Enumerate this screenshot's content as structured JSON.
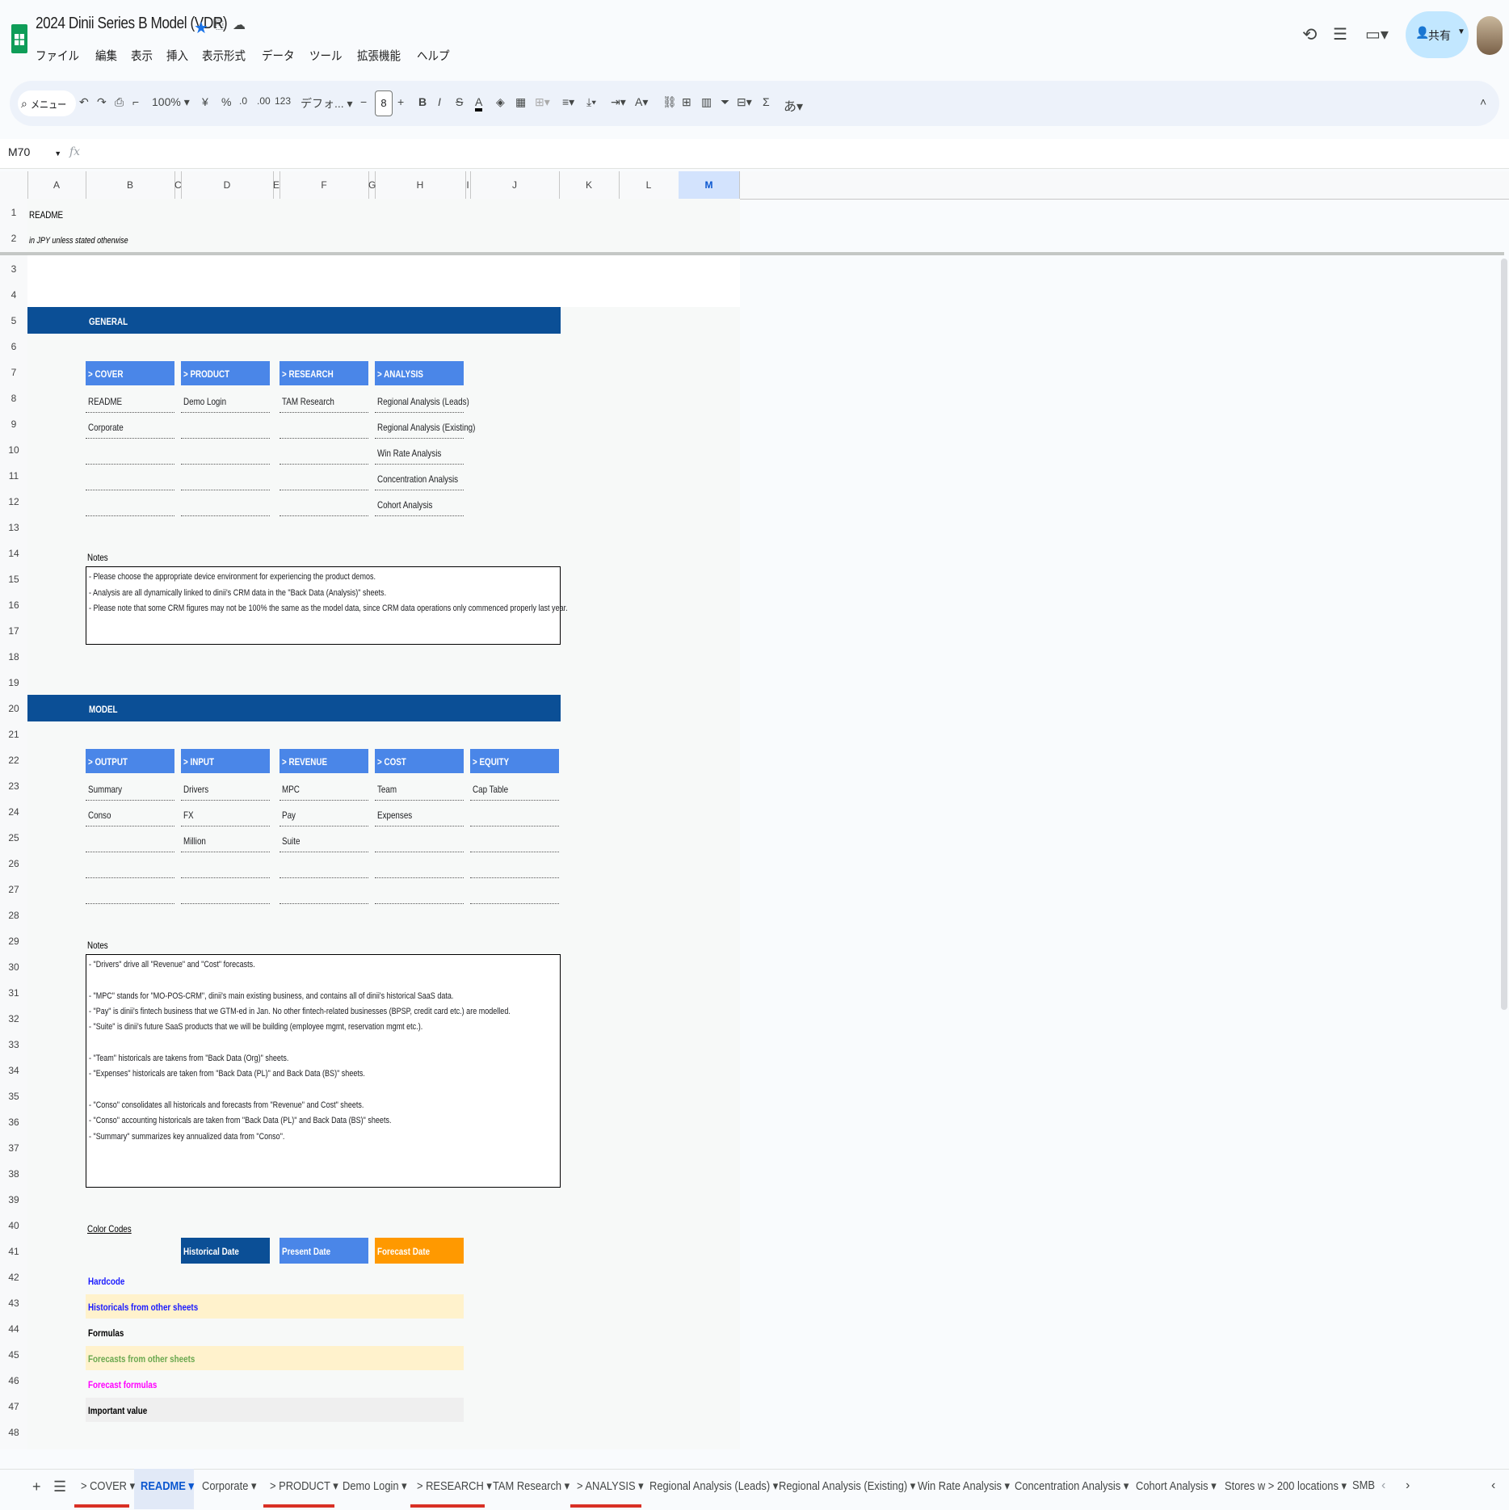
{
  "app": {
    "title": "2024 Dinii Series B Model (VDR)",
    "menu": [
      "ファイル",
      "編集",
      "表示",
      "挿入",
      "表示形式",
      "データ",
      "ツール",
      "拡張機能",
      "ヘルプ"
    ],
    "share_label": "共有"
  },
  "toolbar": {
    "search_label": "メニュー",
    "zoom": "100%",
    "currency": "¥",
    "percent": "%",
    "dec_less": ".0",
    "dec_more": ".00",
    "number_format": "123",
    "font": "デフォ...",
    "font_size": "8",
    "bold": "B",
    "italic": "I",
    "text_color": "A",
    "input_tools": "あ",
    "sum": "Σ"
  },
  "formula_bar": {
    "name_box": "M70",
    "fx": "fx"
  },
  "grid": {
    "columns": [
      "A",
      "B",
      "C",
      "D",
      "E",
      "F",
      "G",
      "H",
      "I",
      "J",
      "K",
      "L",
      "M"
    ],
    "rows": [
      "1",
      "2",
      "3",
      "4",
      "5",
      "6",
      "7",
      "8",
      "9",
      "10",
      "11",
      "12",
      "13",
      "14",
      "15",
      "16",
      "17",
      "18",
      "19",
      "20",
      "21",
      "22",
      "23",
      "24",
      "25",
      "26",
      "27",
      "28",
      "29",
      "30",
      "31",
      "32",
      "33",
      "34",
      "35",
      "36",
      "37",
      "38",
      "39",
      "40",
      "41",
      "42",
      "43",
      "44",
      "45",
      "46",
      "47",
      "48"
    ]
  },
  "sheet": {
    "a1": "README",
    "a2": "in JPY unless stated otherwise",
    "general": {
      "title": "GENERAL",
      "categories": [
        {
          "head": "> COVER",
          "items": [
            "README",
            "Corporate",
            "",
            "",
            ""
          ]
        },
        {
          "head": "> PRODUCT",
          "items": [
            "Demo Login",
            "",
            "",
            "",
            ""
          ]
        },
        {
          "head": "> RESEARCH",
          "items": [
            "TAM Research",
            "",
            "",
            "",
            ""
          ]
        },
        {
          "head": "> ANALYSIS",
          "items": [
            "Regional Analysis (Leads)",
            "Regional Analysis (Existing)",
            "Win Rate Analysis",
            "Concentration Analysis",
            "Cohort Analysis"
          ]
        }
      ],
      "notes_label": "Notes",
      "notes": [
        "- Please choose the appropriate device environment for experiencing the product demos.",
        "- Analysis are all dynamically linked to dinii's CRM data in the \"Back Data (Analysis)\" sheets.",
        "- Please note that some CRM figures may not be 100% the same as the model data, since CRM data operations only commenced properly last year."
      ]
    },
    "model": {
      "title": "MODEL",
      "categories": [
        {
          "head": "> OUTPUT",
          "items": [
            "Summary",
            "Conso",
            "",
            "",
            ""
          ]
        },
        {
          "head": "> INPUT",
          "items": [
            "Drivers",
            "FX",
            "Million",
            "",
            ""
          ]
        },
        {
          "head": "> REVENUE",
          "items": [
            "MPC",
            "Pay",
            "Suite",
            "",
            ""
          ]
        },
        {
          "head": "> COST",
          "items": [
            "Team",
            "Expenses",
            "",
            "",
            ""
          ]
        },
        {
          "head": "> EQUITY",
          "items": [
            "Cap Table",
            "",
            "",
            "",
            ""
          ]
        }
      ],
      "notes_label": "Notes",
      "notes": [
        "- \"Drivers\" drive all \"Revenue\" and \"Cost\" forecasts.",
        "",
        "- \"MPC\" stands for \"MO-POS-CRM\", dinii's main existing business, and contains all of dinii's historical SaaS data.",
        "- \"Pay\" is dinii's fintech business that we GTM-ed in Jan. No other fintech-related businesses (BPSP, credit card etc.) are modelled.",
        "- \"Suite\" is dinii's future SaaS products that we will be building (employee mgmt, reservation mgmt etc.).",
        "",
        "- \"Team\" historicals are takens from \"Back Data (Org)\" sheets.",
        "- \"Expenses\" historicals are taken from \"Back Data (PL)\" and Back Data (BS)\" sheets.",
        "",
        "- \"Conso\" consolidates all historicals and forecasts from \"Revenue\" and Cost\" sheets.",
        "- \"Conso\" accounting historicals are taken from \"Back Data (PL)\" and Back Data (BS)\" sheets.",
        "- \"Summary\" summarizes key annualized data from \"Conso\"."
      ]
    },
    "color_codes": {
      "label": "Color Codes",
      "dates": [
        {
          "label": "Historical Date",
          "color": "#0b4f96"
        },
        {
          "label": "Present Date",
          "color": "#4a86e8"
        },
        {
          "label": "Forecast Date",
          "color": "#ff9900"
        }
      ],
      "rows": [
        {
          "label": "Hardcode",
          "color": "#1a1aff",
          "bg": ""
        },
        {
          "label": "Historicals from other sheets",
          "color": "#1a1aff",
          "bg": "#fff2cc"
        },
        {
          "label": "Formulas",
          "color": "#000000",
          "bg": ""
        },
        {
          "label": "Forecasts from other sheets",
          "color": "#6aa84f",
          "bg": "#fff2cc"
        },
        {
          "label": "Forecast formulas",
          "color": "#ff00ff",
          "bg": ""
        },
        {
          "label": "Important value",
          "color": "#000000",
          "bg": "#efefef"
        }
      ]
    }
  },
  "tabs": [
    {
      "label": "> COVER",
      "active": false,
      "red": true
    },
    {
      "label": "README",
      "active": true,
      "red": false
    },
    {
      "label": "Corporate",
      "active": false,
      "red": false
    },
    {
      "label": "> PRODUCT",
      "active": false,
      "red": true
    },
    {
      "label": "Demo Login",
      "active": false,
      "red": false
    },
    {
      "label": "> RESEARCH",
      "active": false,
      "red": true
    },
    {
      "label": "TAM Research",
      "active": false,
      "red": false
    },
    {
      "label": "> ANALYSIS",
      "active": false,
      "red": true
    },
    {
      "label": "Regional Analysis (Leads)",
      "active": false,
      "red": false
    },
    {
      "label": "Regional Analysis (Existing)",
      "active": false,
      "red": false
    },
    {
      "label": "Win Rate Analysis",
      "active": false,
      "red": false
    },
    {
      "label": "Concentration Analysis",
      "active": false,
      "red": false
    },
    {
      "label": "Cohort Analysis",
      "active": false,
      "red": false
    },
    {
      "label": "Stores w > 200 locations",
      "active": false,
      "red": false
    },
    {
      "label": "SMB",
      "active": false,
      "red": false
    }
  ]
}
